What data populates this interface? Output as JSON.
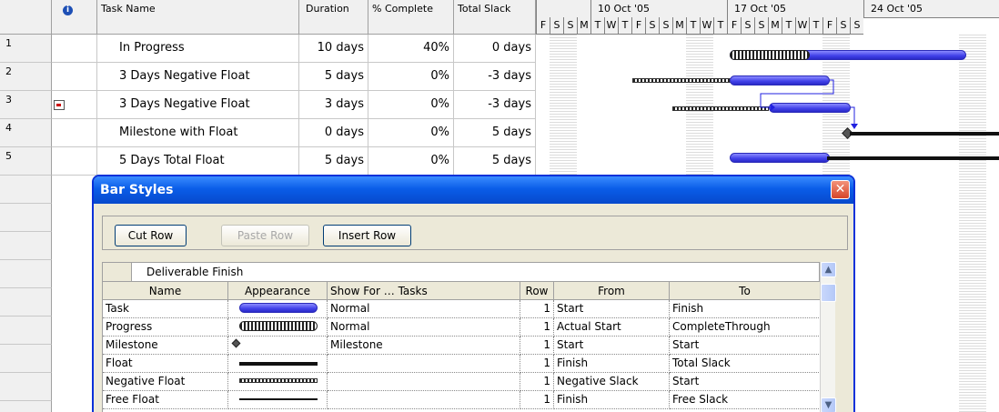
{
  "grid": {
    "columns": {
      "info": "i",
      "task_name": "Task Name",
      "duration": "Duration",
      "pct_complete": "% Complete",
      "total_slack": "Total Slack"
    },
    "rows": [
      {
        "id": "1",
        "name": "In Progress",
        "duration": "10 days",
        "pct": "40%",
        "slack": "0 days"
      },
      {
        "id": "2",
        "name": "3 Days Negative Float",
        "duration": "5 days",
        "pct": "0%",
        "slack": "-3 days"
      },
      {
        "id": "3",
        "name": "3 Days Negative Float",
        "duration": "3 days",
        "pct": "0%",
        "slack": "-3 days"
      },
      {
        "id": "4",
        "name": "Milestone with Float",
        "duration": "0 days",
        "pct": "0%",
        "slack": "5 days"
      },
      {
        "id": "5",
        "name": "5 Days Total Float",
        "duration": "5 days",
        "pct": "0%",
        "slack": "5 days"
      }
    ]
  },
  "timescale": {
    "weeks": [
      "10 Oct '05",
      "17 Oct '05",
      "24 Oct '05"
    ],
    "days": [
      "F",
      "S",
      "S",
      "M",
      "T",
      "W",
      "T",
      "F",
      "S",
      "S",
      "M",
      "T",
      "W",
      "T",
      "F",
      "S",
      "S",
      "M",
      "T",
      "W",
      "T",
      "F",
      "S",
      "S"
    ]
  },
  "dialog": {
    "title": "Bar Styles",
    "buttons": {
      "cut": "Cut Row",
      "paste": "Paste Row",
      "insert": "Insert Row"
    },
    "edit_value": "Deliverable Finish",
    "headers": {
      "name": "Name",
      "appearance": "Appearance",
      "show_for": "Show For … Tasks",
      "row": "Row",
      "from": "From",
      "to": "To"
    },
    "rows": [
      {
        "name": "Task",
        "appearance": "blue-bar",
        "show_for": "Normal",
        "row": "1",
        "from": "Start",
        "to": "Finish"
      },
      {
        "name": "Progress",
        "appearance": "progress-bar",
        "show_for": "Normal",
        "row": "1",
        "from": "Actual Start",
        "to": "CompleteThrough"
      },
      {
        "name": "Milestone",
        "appearance": "diamond",
        "show_for": "Milestone",
        "row": "1",
        "from": "Start",
        "to": "Start"
      },
      {
        "name": "Float",
        "appearance": "black-line",
        "show_for": "",
        "row": "1",
        "from": "Finish",
        "to": "Total Slack"
      },
      {
        "name": "Negative Float",
        "appearance": "hatched-bar",
        "show_for": "",
        "row": "1",
        "from": "Negative Slack",
        "to": "Start"
      },
      {
        "name": "Free Float",
        "appearance": "thin-line",
        "show_for": "",
        "row": "1",
        "from": "Finish",
        "to": "Free Slack"
      }
    ]
  },
  "colors": {
    "task_bar": "#4040e8",
    "title_bar": "#0a5de8",
    "close_button": "#d5452a",
    "dialog_bg": "#ece9d8"
  }
}
